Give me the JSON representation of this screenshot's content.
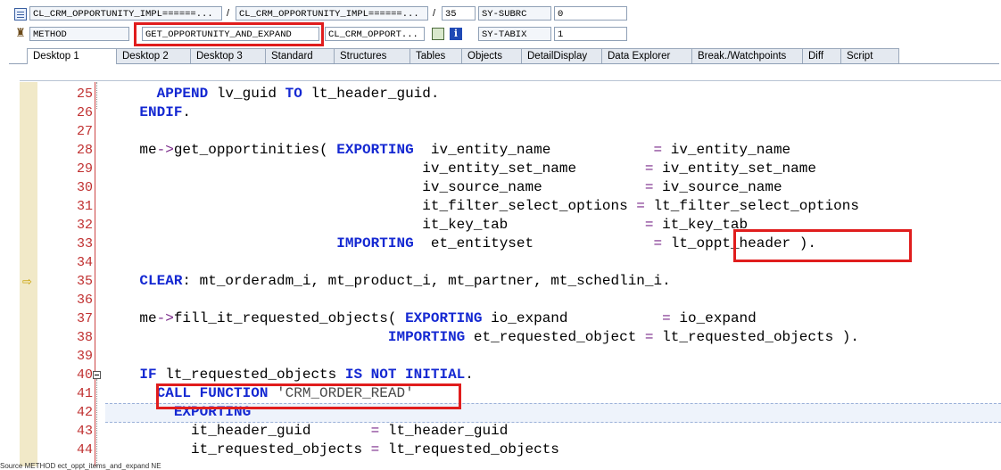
{
  "header": {
    "row1": {
      "field1": "CL_CRM_OPPORTUNITY_IMPL======...",
      "slash1": "/",
      "field2": "CL_CRM_OPPORTUNITY_IMPL======...",
      "slash2": "/",
      "line_no": "35",
      "var_name": "SY-SUBRC",
      "var_value": "0"
    },
    "row2": {
      "type": "METHOD",
      "method_name": "GET_OPPORTUNITY_AND_EXPAND",
      "class_name": "CL_CRM_OPPORT...",
      "var_name": "SY-TABIX",
      "var_value": "1"
    }
  },
  "tabs": [
    {
      "label": "Desktop 1",
      "active": true
    },
    {
      "label": "Desktop 2"
    },
    {
      "label": "Desktop 3"
    },
    {
      "label": "Standard"
    },
    {
      "label": "Structures"
    },
    {
      "label": "Tables"
    },
    {
      "label": "Objects"
    },
    {
      "label": "DetailDisplay"
    },
    {
      "label": "Data Explorer"
    },
    {
      "label": "Break./Watchpoints"
    },
    {
      "label": "Diff"
    },
    {
      "label": "Script"
    }
  ],
  "code_lines": [
    {
      "n": "25",
      "html": "      <span class=\"kw\">APPEND</span> lv_guid <span class=\"kw\">TO</span> lt_header_guid."
    },
    {
      "n": "26",
      "html": "    <span class=\"kw\">ENDIF</span>."
    },
    {
      "n": "27",
      "html": ""
    },
    {
      "n": "28",
      "html": "    me<span class=\"op\">-></span>get_opportinities( <span class=\"kw\">EXPORTING</span>  iv_entity_name            <span class=\"op\">=</span> iv_entity_name"
    },
    {
      "n": "29",
      "html": "                                     iv_entity_set_name        <span class=\"op\">=</span> iv_entity_set_name"
    },
    {
      "n": "30",
      "html": "                                     iv_source_name            <span class=\"op\">=</span> iv_source_name"
    },
    {
      "n": "31",
      "html": "                                     it_filter_select_options <span class=\"op\">=</span> lt_filter_select_options"
    },
    {
      "n": "32",
      "html": "                                     it_key_tab                <span class=\"op\">=</span> it_key_tab"
    },
    {
      "n": "33",
      "html": "                           <span class=\"kw\">IMPORTING</span>  et_entityset              <span class=\"op\">=</span> lt_oppt_header )."
    },
    {
      "n": "34",
      "html": ""
    },
    {
      "n": "35",
      "html": "    <span class=\"kw\">CLEAR</span>: mt_orderadm_i, mt_product_i, mt_partner, mt_schedlin_i.",
      "current": true
    },
    {
      "n": "36",
      "html": ""
    },
    {
      "n": "37",
      "html": "    me<span class=\"op\">-></span>fill_it_requested_objects( <span class=\"kw\">EXPORTING</span> io_expand           <span class=\"op\">=</span> io_expand"
    },
    {
      "n": "38",
      "html": "                                 <span class=\"kw\">IMPORTING</span> et_requested_object <span class=\"op\">=</span> lt_requested_objects )."
    },
    {
      "n": "39",
      "html": ""
    },
    {
      "n": "40",
      "html": "    <span class=\"kw\">IF</span> lt_requested_objects <span class=\"kw\">IS NOT INITIAL</span>.",
      "fold": true
    },
    {
      "n": "41",
      "html": "      <span class=\"kw\">CALL FUNCTION</span> <span class=\"str\">'CRM_ORDER_READ'</span>"
    },
    {
      "n": "42",
      "html": "        <span class=\"kw\">EXPORTING</span>",
      "cursor": true
    },
    {
      "n": "43",
      "html": "          it_header_guid       <span class=\"op\">=</span> lt_header_guid"
    },
    {
      "n": "44",
      "html": "          it_requested_objects <span class=\"op\">=</span> lt_requested_objects"
    }
  ],
  "status_text": "Source METHOD   ect_oppt_items_and_expand  NE"
}
